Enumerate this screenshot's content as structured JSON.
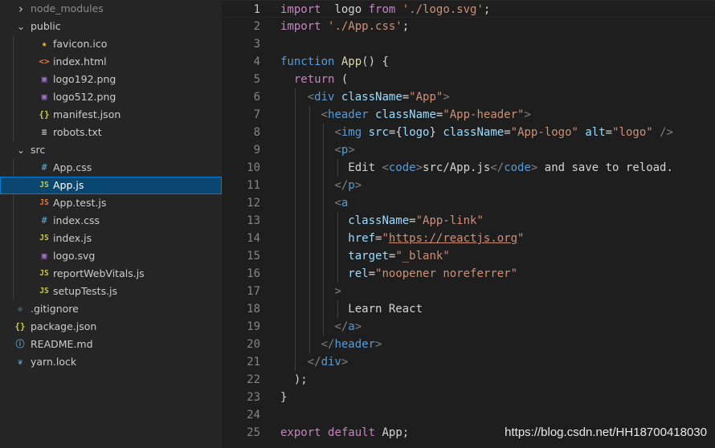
{
  "explorer": {
    "items": [
      {
        "label": "node_modules",
        "kind": "folder",
        "state": "collapsed",
        "icon": "chevron-right-icon"
      },
      {
        "label": "public",
        "kind": "folder",
        "state": "expanded",
        "icon": "chevron-down-icon"
      },
      {
        "label": "favicon.ico",
        "kind": "file",
        "icon": "star-icon",
        "icon_glyph": "★",
        "icon_color": "#e8c547"
      },
      {
        "label": "index.html",
        "kind": "file",
        "icon": "html-icon",
        "icon_glyph": "<>",
        "icon_color": "#e37933"
      },
      {
        "label": "logo192.png",
        "kind": "file",
        "icon": "image-icon",
        "icon_glyph": "▣",
        "icon_color": "#a074c4"
      },
      {
        "label": "logo512.png",
        "kind": "file",
        "icon": "image-icon",
        "icon_glyph": "▣",
        "icon_color": "#a074c4"
      },
      {
        "label": "manifest.json",
        "kind": "file",
        "icon": "json-icon",
        "icon_glyph": "{}",
        "icon_color": "#cbcb41"
      },
      {
        "label": "robots.txt",
        "kind": "file",
        "icon": "text-icon",
        "icon_glyph": "≡",
        "icon_color": "#cccccc"
      },
      {
        "label": "src",
        "kind": "folder",
        "state": "expanded",
        "icon": "chevron-down-icon"
      },
      {
        "label": "App.css",
        "kind": "file",
        "icon": "css-icon",
        "icon_glyph": "#",
        "icon_color": "#519aba"
      },
      {
        "label": "App.js",
        "kind": "file",
        "icon": "js-icon",
        "icon_glyph": "JS",
        "icon_color": "#cbcb41",
        "selected": true
      },
      {
        "label": "App.test.js",
        "kind": "file",
        "icon": "js-test-icon",
        "icon_glyph": "JS",
        "icon_color": "#e37933"
      },
      {
        "label": "index.css",
        "kind": "file",
        "icon": "css-icon",
        "icon_glyph": "#",
        "icon_color": "#519aba"
      },
      {
        "label": "index.js",
        "kind": "file",
        "icon": "js-icon",
        "icon_glyph": "JS",
        "icon_color": "#cbcb41"
      },
      {
        "label": "logo.svg",
        "kind": "file",
        "icon": "svg-icon",
        "icon_glyph": "▣",
        "icon_color": "#a074c4"
      },
      {
        "label": "reportWebVitals.js",
        "kind": "file",
        "icon": "js-icon",
        "icon_glyph": "JS",
        "icon_color": "#cbcb41"
      },
      {
        "label": "setupTests.js",
        "kind": "file",
        "icon": "js-icon",
        "icon_glyph": "JS",
        "icon_color": "#cbcb41"
      },
      {
        "label": ".gitignore",
        "kind": "file",
        "icon": "git-icon",
        "icon_glyph": "◆",
        "icon_color": "#41535b"
      },
      {
        "label": "package.json",
        "kind": "file",
        "icon": "json-icon",
        "icon_glyph": "{}",
        "icon_color": "#cbcb41"
      },
      {
        "label": "README.md",
        "kind": "file",
        "icon": "info-icon",
        "icon_glyph": "ⓘ",
        "icon_color": "#519aba"
      },
      {
        "label": "yarn.lock",
        "kind": "file",
        "icon": "yarn-icon",
        "icon_glyph": "❦",
        "icon_color": "#519aba"
      }
    ]
  },
  "editor": {
    "active_line": 1,
    "lines": [
      {
        "n": "1",
        "tokens": [
          [
            "kc",
            "import"
          ],
          [
            "",
            "  logo "
          ],
          [
            "kc",
            "from"
          ],
          [
            "",
            " "
          ],
          [
            "s",
            "'./logo.svg'"
          ],
          [
            "",
            ";"
          ]
        ]
      },
      {
        "n": "2",
        "tokens": [
          [
            "kc",
            "import"
          ],
          [
            "",
            " "
          ],
          [
            "s",
            "'./App.css'"
          ],
          [
            "",
            ";"
          ]
        ]
      },
      {
        "n": "3",
        "tokens": []
      },
      {
        "n": "4",
        "tokens": [
          [
            "k",
            "function"
          ],
          [
            "",
            " "
          ],
          [
            "f",
            "App"
          ],
          [
            "",
            "() {"
          ]
        ]
      },
      {
        "n": "5",
        "tokens": [
          [
            "",
            "  "
          ],
          [
            "kc",
            "return"
          ],
          [
            "",
            " ("
          ]
        ]
      },
      {
        "n": "6",
        "tokens": [
          [
            "",
            "    "
          ],
          [
            "p",
            "<"
          ],
          [
            "t",
            "div"
          ],
          [
            "",
            " "
          ],
          [
            "a",
            "className"
          ],
          [
            "",
            "="
          ],
          [
            "s",
            "\"App\""
          ],
          [
            "p",
            ">"
          ]
        ]
      },
      {
        "n": "7",
        "tokens": [
          [
            "",
            "      "
          ],
          [
            "p",
            "<"
          ],
          [
            "t",
            "header"
          ],
          [
            "",
            " "
          ],
          [
            "a",
            "className"
          ],
          [
            "",
            "="
          ],
          [
            "s",
            "\"App-header\""
          ],
          [
            "p",
            ">"
          ]
        ]
      },
      {
        "n": "8",
        "tokens": [
          [
            "",
            "        "
          ],
          [
            "p",
            "<"
          ],
          [
            "t",
            "img"
          ],
          [
            "",
            " "
          ],
          [
            "a",
            "src"
          ],
          [
            "",
            "={"
          ],
          [
            "v",
            "logo"
          ],
          [
            "",
            "} "
          ],
          [
            "a",
            "className"
          ],
          [
            "",
            "="
          ],
          [
            "s",
            "\"App-logo\""
          ],
          [
            "",
            " "
          ],
          [
            "a",
            "alt"
          ],
          [
            "",
            "="
          ],
          [
            "s",
            "\"logo\""
          ],
          [
            "",
            " "
          ],
          [
            "p",
            "/>"
          ]
        ]
      },
      {
        "n": "9",
        "tokens": [
          [
            "",
            "        "
          ],
          [
            "p",
            "<"
          ],
          [
            "t",
            "p"
          ],
          [
            "p",
            ">"
          ]
        ]
      },
      {
        "n": "10",
        "tokens": [
          [
            "",
            "          Edit "
          ],
          [
            "p",
            "<"
          ],
          [
            "t",
            "code"
          ],
          [
            "p",
            ">"
          ],
          [
            "",
            "src/App.js"
          ],
          [
            "p",
            "</"
          ],
          [
            "t",
            "code"
          ],
          [
            "p",
            ">"
          ],
          [
            "",
            " and save to reload."
          ]
        ]
      },
      {
        "n": "11",
        "tokens": [
          [
            "",
            "        "
          ],
          [
            "p",
            "</"
          ],
          [
            "t",
            "p"
          ],
          [
            "p",
            ">"
          ]
        ]
      },
      {
        "n": "12",
        "tokens": [
          [
            "",
            "        "
          ],
          [
            "p",
            "<"
          ],
          [
            "t",
            "a"
          ]
        ]
      },
      {
        "n": "13",
        "tokens": [
          [
            "",
            "          "
          ],
          [
            "a",
            "className"
          ],
          [
            "",
            "="
          ],
          [
            "s",
            "\"App-link\""
          ]
        ]
      },
      {
        "n": "14",
        "tokens": [
          [
            "",
            "          "
          ],
          [
            "a",
            "href"
          ],
          [
            "",
            "="
          ],
          [
            "s",
            "\""
          ],
          [
            "su",
            "https://reactjs.org"
          ],
          [
            "s",
            "\""
          ]
        ]
      },
      {
        "n": "15",
        "tokens": [
          [
            "",
            "          "
          ],
          [
            "a",
            "target"
          ],
          [
            "",
            "="
          ],
          [
            "s",
            "\"_blank\""
          ]
        ]
      },
      {
        "n": "16",
        "tokens": [
          [
            "",
            "          "
          ],
          [
            "a",
            "rel"
          ],
          [
            "",
            "="
          ],
          [
            "s",
            "\"noopener noreferrer\""
          ]
        ]
      },
      {
        "n": "17",
        "tokens": [
          [
            "",
            "        "
          ],
          [
            "p",
            ">"
          ]
        ]
      },
      {
        "n": "18",
        "tokens": [
          [
            "",
            "          Learn React"
          ]
        ]
      },
      {
        "n": "19",
        "tokens": [
          [
            "",
            "        "
          ],
          [
            "p",
            "</"
          ],
          [
            "t",
            "a"
          ],
          [
            "p",
            ">"
          ]
        ]
      },
      {
        "n": "20",
        "tokens": [
          [
            "",
            "      "
          ],
          [
            "p",
            "</"
          ],
          [
            "t",
            "header"
          ],
          [
            "p",
            ">"
          ]
        ]
      },
      {
        "n": "21",
        "tokens": [
          [
            "",
            "    "
          ],
          [
            "p",
            "</"
          ],
          [
            "t",
            "div"
          ],
          [
            "p",
            ">"
          ]
        ]
      },
      {
        "n": "22",
        "tokens": [
          [
            "",
            "  );"
          ]
        ]
      },
      {
        "n": "23",
        "tokens": [
          [
            "",
            "}"
          ]
        ]
      },
      {
        "n": "24",
        "tokens": []
      },
      {
        "n": "25",
        "tokens": [
          [
            "kc",
            "export"
          ],
          [
            "",
            " "
          ],
          [
            "kc",
            "default"
          ],
          [
            "",
            " App;"
          ]
        ]
      }
    ]
  },
  "watermark": "https://blog.csdn.net/HH18700418030"
}
